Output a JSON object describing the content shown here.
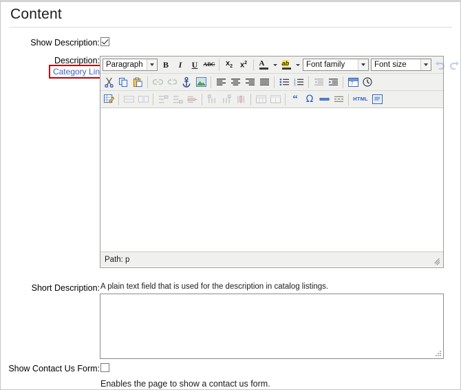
{
  "page": {
    "title": "Content"
  },
  "fields": {
    "show_description": {
      "label": "Show Description:",
      "checked": true,
      "link_label": "Category Link"
    },
    "description": {
      "label": "Description:"
    },
    "short_description": {
      "label": "Short Description:",
      "hint": "A plain text field that is used for the description in catalog listings.",
      "value": ""
    },
    "show_contact_us_form": {
      "label": "Show Contact Us Form:",
      "checked": false,
      "hint": "Enables the page to show a contact us form."
    }
  },
  "editor": {
    "selects": {
      "format": "Paragraph",
      "font_family": "Font family",
      "font_size": "Font size"
    },
    "status": {
      "path_label": "Path: p"
    },
    "content": "",
    "toolbar_rows": [
      {
        "name": "row-1",
        "items": [
          {
            "name": "format-select",
            "kind": "select",
            "value": "Paragraph"
          },
          {
            "name": "bold-icon",
            "kind": "button",
            "label": "B"
          },
          {
            "name": "italic-icon",
            "kind": "button",
            "label": "I"
          },
          {
            "name": "underline-icon",
            "kind": "button",
            "label": "U"
          },
          {
            "name": "strikethrough-icon",
            "kind": "button",
            "label": "ABC"
          },
          {
            "name": "separator",
            "kind": "sep"
          },
          {
            "name": "subscript-icon",
            "kind": "button",
            "label": "x2"
          },
          {
            "name": "superscript-icon",
            "kind": "button",
            "label": "x2"
          },
          {
            "name": "separator",
            "kind": "sep"
          },
          {
            "name": "text-color-icon",
            "kind": "button",
            "label": "A"
          },
          {
            "name": "text-color-dropdown-arrow",
            "kind": "arrow"
          },
          {
            "name": "background-color-icon",
            "kind": "button",
            "label": "ab"
          },
          {
            "name": "background-color-dropdown-arrow",
            "kind": "arrow"
          },
          {
            "name": "font-family-select",
            "kind": "select",
            "value": "Font family"
          },
          {
            "name": "font-size-select",
            "kind": "select",
            "value": "Font size"
          },
          {
            "name": "undo-icon",
            "kind": "button",
            "disabled": true
          },
          {
            "name": "redo-icon",
            "kind": "button",
            "disabled": true
          }
        ]
      },
      {
        "name": "row-2",
        "items": [
          {
            "name": "cut-icon",
            "kind": "button"
          },
          {
            "name": "copy-icon",
            "kind": "button"
          },
          {
            "name": "paste-icon",
            "kind": "button"
          },
          {
            "name": "separator",
            "kind": "sep"
          },
          {
            "name": "insert-link-icon",
            "kind": "button",
            "disabled": true
          },
          {
            "name": "unlink-icon",
            "kind": "button",
            "disabled": true
          },
          {
            "name": "anchor-icon",
            "kind": "button"
          },
          {
            "name": "insert-image-icon",
            "kind": "button"
          },
          {
            "name": "separator",
            "kind": "sep"
          },
          {
            "name": "align-left-icon",
            "kind": "button"
          },
          {
            "name": "align-center-icon",
            "kind": "button"
          },
          {
            "name": "align-right-icon",
            "kind": "button"
          },
          {
            "name": "align-justify-icon",
            "kind": "button"
          },
          {
            "name": "separator",
            "kind": "sep"
          },
          {
            "name": "bullet-list-icon",
            "kind": "button"
          },
          {
            "name": "numbered-list-icon",
            "kind": "button"
          },
          {
            "name": "separator",
            "kind": "sep"
          },
          {
            "name": "outdent-icon",
            "kind": "button",
            "disabled": true
          },
          {
            "name": "indent-icon",
            "kind": "button"
          },
          {
            "name": "separator",
            "kind": "sep"
          },
          {
            "name": "insert-date-icon",
            "kind": "button"
          },
          {
            "name": "insert-time-icon",
            "kind": "button"
          }
        ]
      },
      {
        "name": "row-3",
        "items": [
          {
            "name": "edit-table-icon",
            "kind": "button"
          },
          {
            "name": "separator",
            "kind": "sep"
          },
          {
            "name": "table-row-properties-icon",
            "kind": "button",
            "disabled": true
          },
          {
            "name": "table-cell-properties-icon",
            "kind": "button",
            "disabled": true
          },
          {
            "name": "separator",
            "kind": "sep"
          },
          {
            "name": "insert-row-before-icon",
            "kind": "button",
            "disabled": true
          },
          {
            "name": "insert-row-after-icon",
            "kind": "button",
            "disabled": true
          },
          {
            "name": "delete-row-icon",
            "kind": "button",
            "disabled": true
          },
          {
            "name": "separator",
            "kind": "sep"
          },
          {
            "name": "insert-column-before-icon",
            "kind": "button",
            "disabled": true
          },
          {
            "name": "insert-column-after-icon",
            "kind": "button",
            "disabled": true
          },
          {
            "name": "delete-column-icon",
            "kind": "button",
            "disabled": true
          },
          {
            "name": "separator",
            "kind": "sep"
          },
          {
            "name": "split-cells-icon",
            "kind": "button",
            "disabled": true
          },
          {
            "name": "merge-cells-icon",
            "kind": "button",
            "disabled": true
          },
          {
            "name": "separator",
            "kind": "sep"
          },
          {
            "name": "blockquote-icon",
            "kind": "button"
          },
          {
            "name": "special-character-icon",
            "kind": "button"
          },
          {
            "name": "horizontal-rule-icon",
            "kind": "button"
          },
          {
            "name": "page-break-icon",
            "kind": "button"
          },
          {
            "name": "separator",
            "kind": "sep"
          },
          {
            "name": "edit-html-icon",
            "kind": "button",
            "label": "HTML"
          },
          {
            "name": "preview-icon",
            "kind": "button"
          }
        ]
      }
    ]
  },
  "colors": {
    "highlight_box": "#c00000",
    "link": "#3a62c8",
    "toolbar_bg": "#f0f0ee",
    "border": "#9a9a9a"
  }
}
